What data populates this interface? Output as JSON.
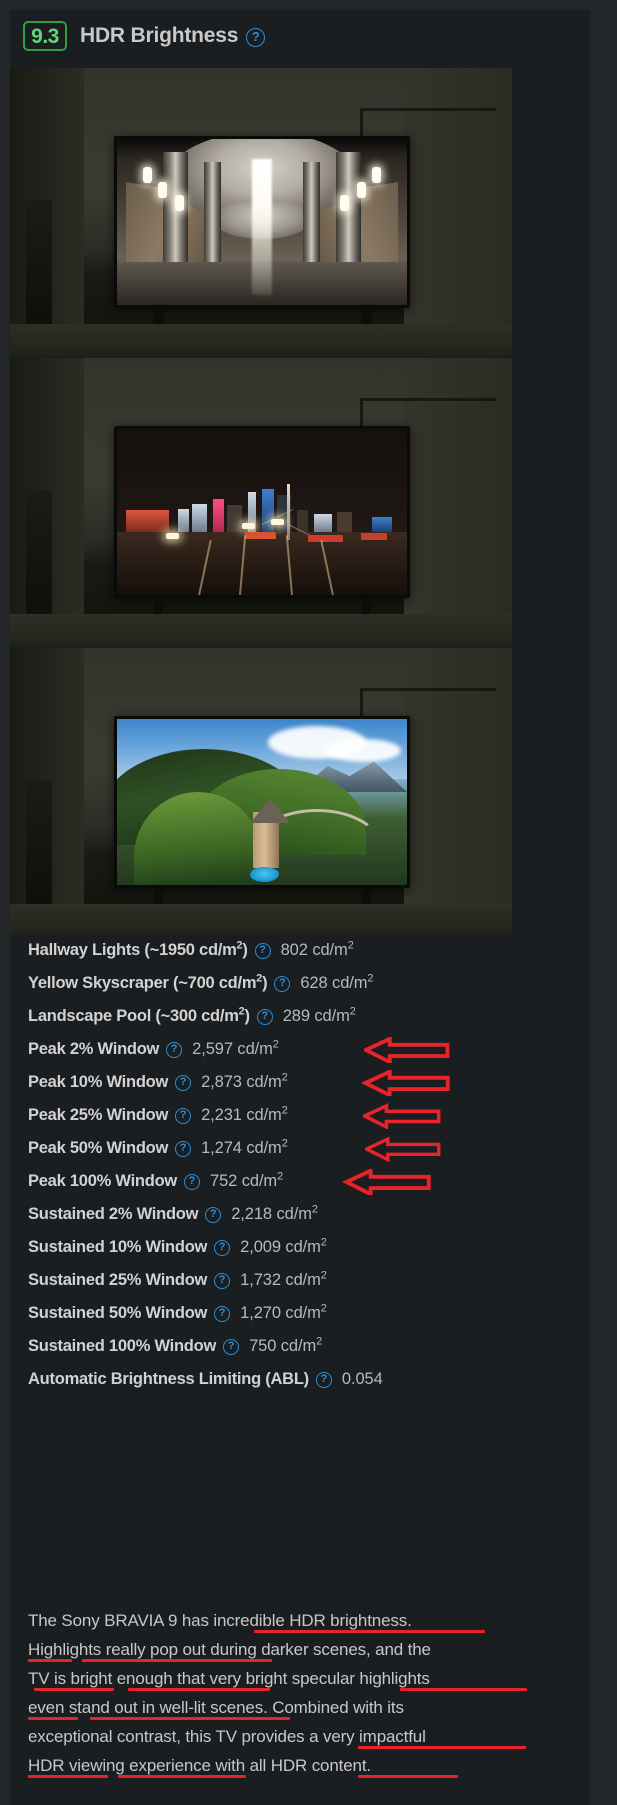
{
  "header": {
    "score": "9.3",
    "title": "HDR Brightness",
    "help_icon": "question-mark-circle-icon",
    "score_border_color": "#2f9e44",
    "score_text_color": "#63d67b"
  },
  "photos": [
    {
      "caption_alt": "TV displaying a brightly lit metro station hallway with chandeliers"
    },
    {
      "caption_alt": "TV displaying a night city skyline with an illuminated cable-stay bridge"
    },
    {
      "caption_alt": "TV displaying a green hillside landscape with a stone tower, pool and mountains"
    }
  ],
  "specs": [
    {
      "label": "Hallway Lights (~1950 cd/m²)",
      "value": "802 cd/m²",
      "arrow": false
    },
    {
      "label": "Yellow Skyscraper (~700 cd/m²)",
      "value": "628 cd/m²",
      "arrow": false
    },
    {
      "label": "Landscape Pool (~300 cd/m²)",
      "value": "289 cd/m²",
      "arrow": false
    },
    {
      "label": "Peak 2% Window",
      "value": "2,597 cd/m²",
      "arrow": true
    },
    {
      "label": "Peak 10% Window",
      "value": "2,873 cd/m²",
      "arrow": true
    },
    {
      "label": "Peak 25% Window",
      "value": "2,231 cd/m²",
      "arrow": true
    },
    {
      "label": "Peak 50% Window",
      "value": "1,274 cd/m²",
      "arrow": true
    },
    {
      "label": "Peak 100% Window",
      "value": "752 cd/m²",
      "arrow": true
    },
    {
      "label": "Sustained 2% Window",
      "value": "2,218 cd/m²",
      "arrow": false
    },
    {
      "label": "Sustained 10% Window",
      "value": "2,009 cd/m²",
      "arrow": false
    },
    {
      "label": "Sustained 25% Window",
      "value": "1,732 cd/m²",
      "arrow": false
    },
    {
      "label": "Sustained 50% Window",
      "value": "1,270 cd/m²",
      "arrow": false
    },
    {
      "label": "Sustained 100% Window",
      "value": "750 cd/m²",
      "arrow": false
    },
    {
      "label": "Automatic Brightness Limiting (ABL)",
      "value": "0.054",
      "arrow": false
    }
  ],
  "summary": {
    "lines": [
      "The Sony BRAVIA 9 has incredible HDR brightness.",
      "Highlights really pop out during darker scenes, and the",
      "TV is bright enough that very bright specular highlights",
      "even stand out in well-lit scenes. Combined with its",
      "exceptional contrast, this TV provides a very impactful",
      "HDR viewing experience with all HDR content."
    ]
  },
  "annotations": {
    "arrow_color": "#e8232a",
    "underline_color": "#e8232a",
    "arrow_count": 5,
    "underline_count": 9
  },
  "colors": {
    "page_background": "#222629",
    "panel_background": "#1b1e21",
    "label_text": "#d2d2d2",
    "value_text": "#b9b9b9",
    "help_icon": "#2a8fd8"
  }
}
